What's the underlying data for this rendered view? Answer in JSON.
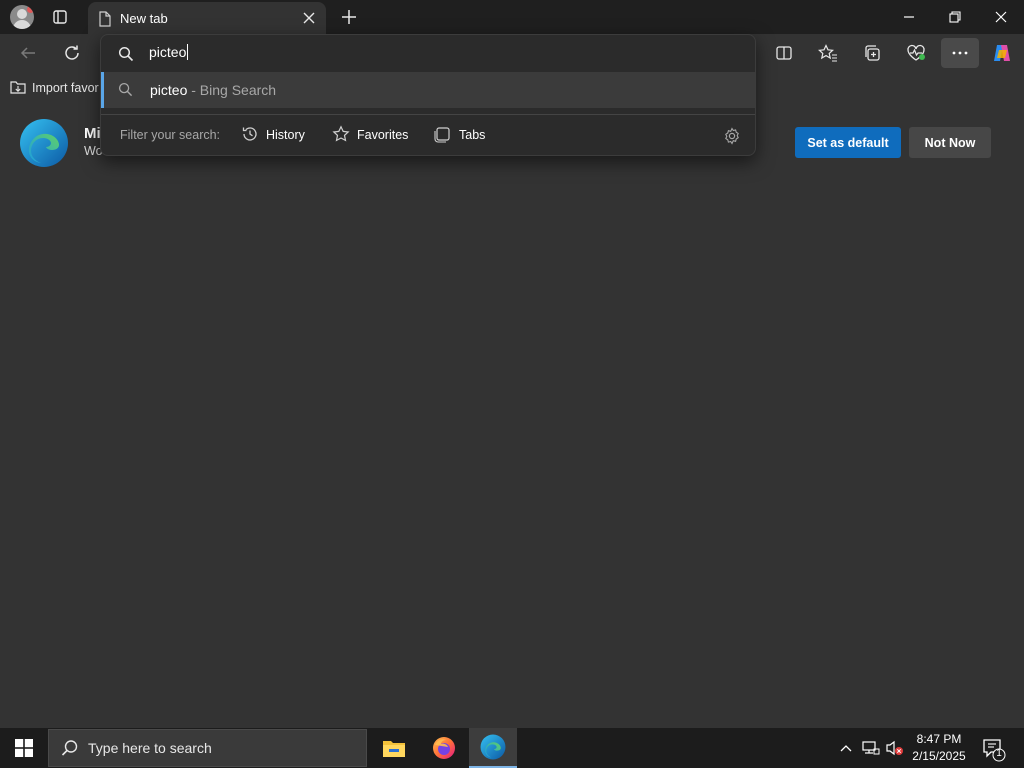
{
  "browser": {
    "tab": {
      "title": "New tab"
    },
    "favorites": {
      "import_label": "Import favor"
    },
    "banner": {
      "title": "Mi",
      "subtitle": "Wo",
      "primary_button": "Set as default",
      "secondary_button": "Not Now"
    },
    "address_dropdown": {
      "query": "picteo",
      "suggestion": {
        "term": "picteo",
        "suffix": " - Bing Search"
      },
      "filter_label": "Filter your search:",
      "filters": [
        {
          "label": "History",
          "icon": "history-icon"
        },
        {
          "label": "Favorites",
          "icon": "star-icon"
        },
        {
          "label": "Tabs",
          "icon": "tabs-icon"
        }
      ]
    },
    "accent_color": "#0f6cbd"
  },
  "taskbar": {
    "search_placeholder": "Type here to search",
    "apps": [
      "file-explorer-icon",
      "firefox-icon",
      "edge-icon"
    ],
    "time": "8:47 PM",
    "date": "2/15/2025",
    "notification_count": "1"
  }
}
